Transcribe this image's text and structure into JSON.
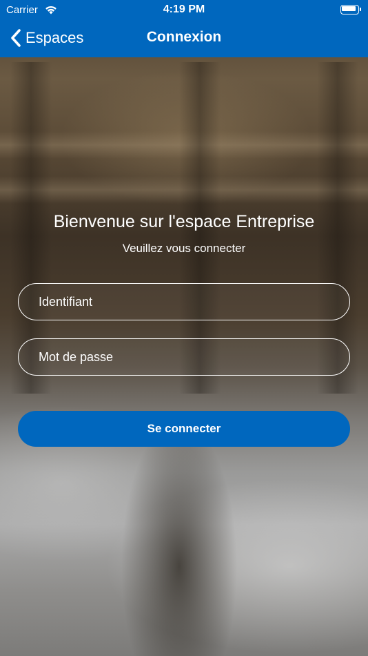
{
  "status_bar": {
    "carrier": "Carrier",
    "time": "4:19 PM"
  },
  "nav": {
    "back_label": "Espaces",
    "title": "Connexion"
  },
  "welcome": {
    "title": "Bienvenue sur l'espace Entreprise",
    "subtitle": "Veuillez vous connecter"
  },
  "form": {
    "login_placeholder": "Identifiant",
    "login_value": "",
    "password_placeholder": "Mot de passe",
    "password_value": "",
    "submit_label": "Se connecter"
  },
  "colors": {
    "brand_blue": "#0067be",
    "text": "#ffffff"
  },
  "icons": {
    "wifi": "wifi-icon",
    "battery": "battery-icon",
    "back": "chevron-left-icon"
  }
}
